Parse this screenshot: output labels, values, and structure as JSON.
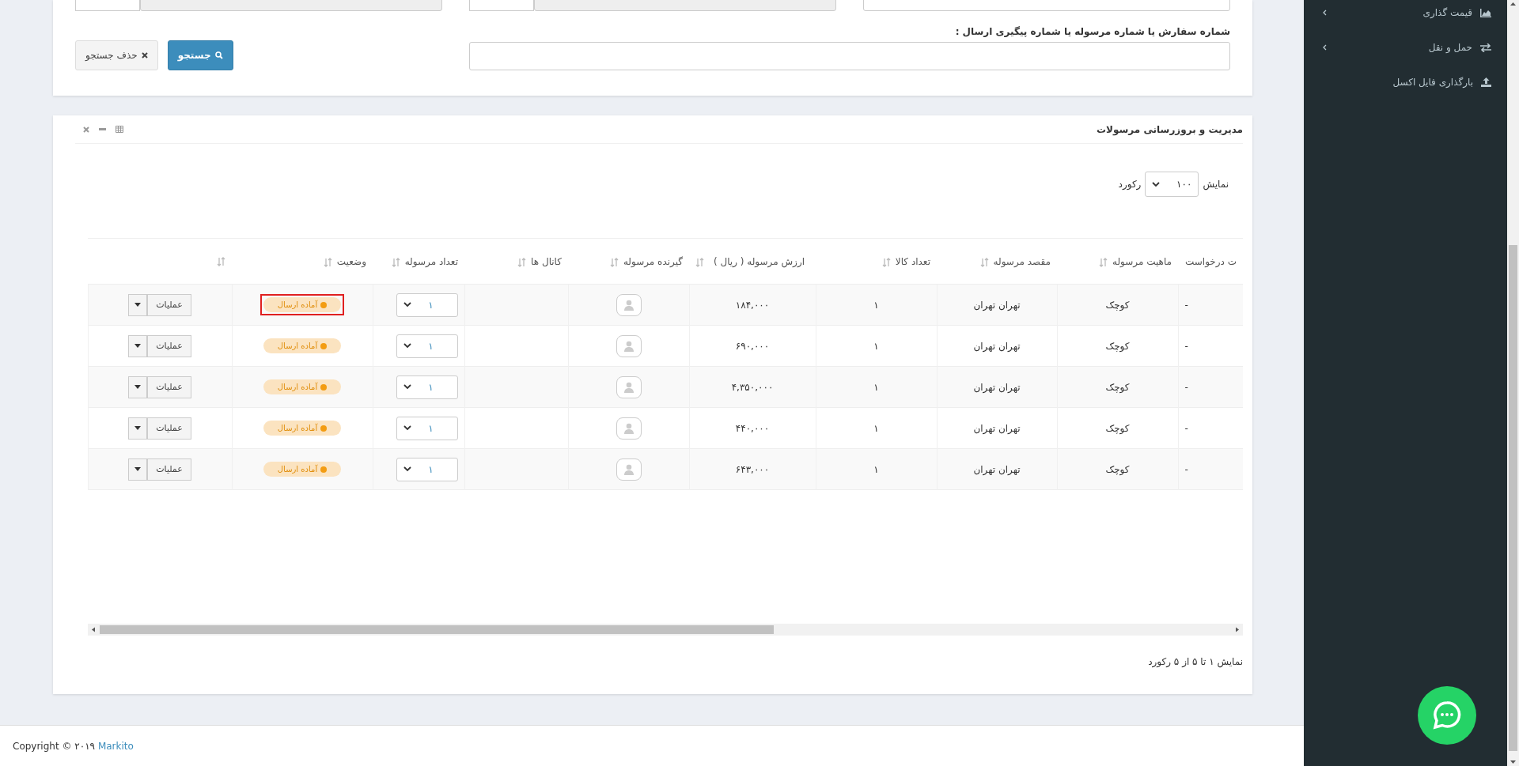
{
  "search_form": {
    "top_fields": [
      {
        "kind": "text",
        "disabled": false
      },
      {
        "kind": "date",
        "disabled": true
      },
      {
        "kind": "date",
        "disabled": true
      }
    ],
    "query_label": "شماره سفارش یا شماره مرسوله یا شماره پیگیری ارسال :",
    "search_button": "جستجو",
    "clear_button": "حذف جستجو"
  },
  "panel": {
    "title": "مدیریت و بروزرسانی مرسولات",
    "page_size": {
      "before": "نمایش",
      "value": "۱۰۰",
      "after": "رکورد"
    },
    "table": {
      "columns": [
        "ت درخواست",
        "ماهیت مرسوله",
        "مقصد مرسوله",
        "تعداد کالا",
        "ارزش مرسوله ( ریال )",
        "گیرنده مرسوله",
        "کانال ها",
        "تعداد مرسوله",
        "وضعیت",
        ""
      ],
      "rows": [
        {
          "request": "-",
          "type": "کوچک",
          "destination": "تهران تهران",
          "items": "۱",
          "value": "۱۸۴,۰۰۰",
          "quantity": "۱",
          "status": "آماده ارسال",
          "highlighted": true,
          "action": "عملیات"
        },
        {
          "request": "-",
          "type": "کوچک",
          "destination": "تهران تهران",
          "items": "۱",
          "value": "۶۹۰,۰۰۰",
          "quantity": "۱",
          "status": "آماده ارسال",
          "highlighted": false,
          "action": "عملیات"
        },
        {
          "request": "-",
          "type": "کوچک",
          "destination": "تهران تهران",
          "items": "۱",
          "value": "۴,۳۵۰,۰۰۰",
          "quantity": "۱",
          "status": "آماده ارسال",
          "highlighted": false,
          "action": "عملیات"
        },
        {
          "request": "-",
          "type": "کوچک",
          "destination": "تهران تهران",
          "items": "۱",
          "value": "۴۴۰,۰۰۰",
          "quantity": "۱",
          "status": "آماده ارسال",
          "highlighted": false,
          "action": "عملیات"
        },
        {
          "request": "-",
          "type": "کوچک",
          "destination": "تهران تهران",
          "items": "۱",
          "value": "۶۴۳,۰۰۰",
          "quantity": "۱",
          "status": "آماده ارسال",
          "highlighted": false,
          "action": "عملیات"
        }
      ]
    },
    "info": "نمایش ۱ تا ۵ از ۵ رکورد"
  },
  "sidebar": {
    "items": [
      {
        "label": "قیمت گذاری",
        "kind": "chart",
        "has_submenu": true
      },
      {
        "label": "حمل و نقل",
        "kind": "exchange",
        "has_submenu": true
      },
      {
        "label": "بارگذاری فایل اکسل",
        "kind": "upload",
        "has_submenu": false
      }
    ]
  },
  "footer": {
    "text": "Copyright © ۲۰۱۹",
    "link": "Markito"
  }
}
